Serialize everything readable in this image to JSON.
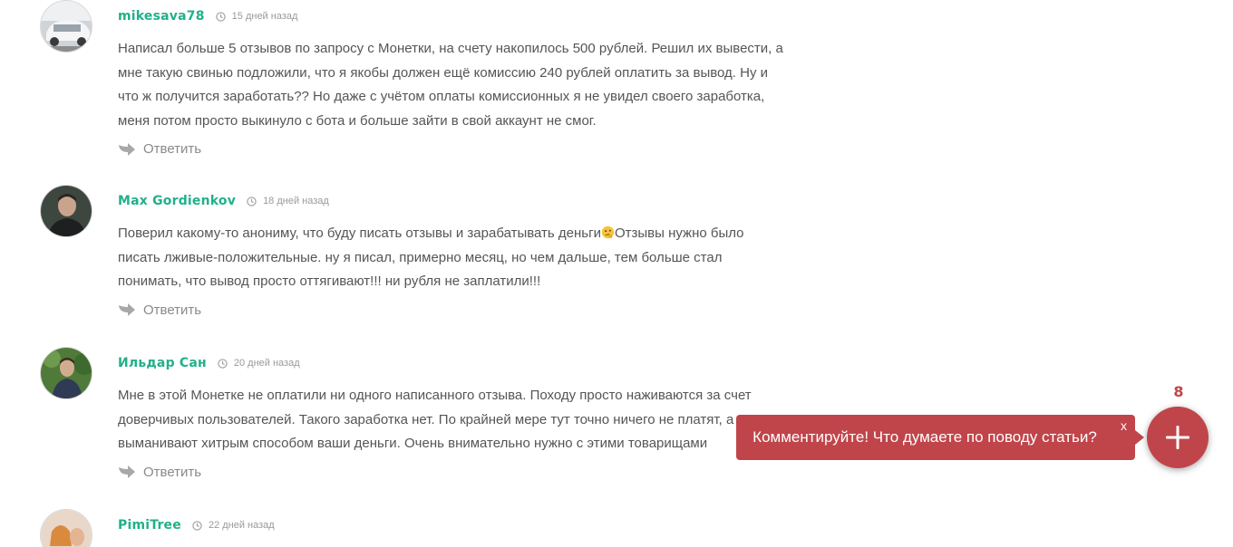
{
  "reply_label": "Ответить",
  "comments": [
    {
      "author": "mikesava78",
      "date": "15 дней назад",
      "text": "Написал больше 5 отзывов по запросу с Монетки, на счету накопилось 500 рублей. Решил их вывести, а мне такую свинью подложили, что я якобы должен ещё комиссию 240 рублей оплатить за вывод. Ну и что ж получится заработать?? Но даже с учётом оплаты комиссионных я не увидел своего заработка, меня потом просто выкинуло с бота и больше зайти в свой аккаунт не смог."
    },
    {
      "author": "Max Gordienkov",
      "date": "18 дней назад",
      "text_before": "Поверил какому-то анониму, что буду писать отзывы и зарабатывать деньги",
      "text_after": "Отзывы нужно было писать лживые-положительные. ну я писал, примерно месяц, но чем дальше, тем больше стал понимать, что вывод просто оттягивают!!! ни рубля не заплатили!!!"
    },
    {
      "author": "Ильдар Сан",
      "date": "20 дней назад",
      "text": "Мне в этой Монетке не оплатили ни одного написанного отзыва. Походу просто наживаются за счет доверчивых пользователей. Такого заработка нет. По крайней мере тут точно ничего не платят, а выманивают хитрым способом ваши деньги. Очень внимательно нужно с этими товарищами"
    },
    {
      "author": "PimiTree",
      "date": "22 дней назад"
    }
  ],
  "cta": {
    "text": "Комментируйте! Что думаете по поводу статьи?",
    "close": "x",
    "count": "8"
  },
  "colors": {
    "author": "#21b08a",
    "accent": "#c0454a",
    "text": "#555555"
  }
}
